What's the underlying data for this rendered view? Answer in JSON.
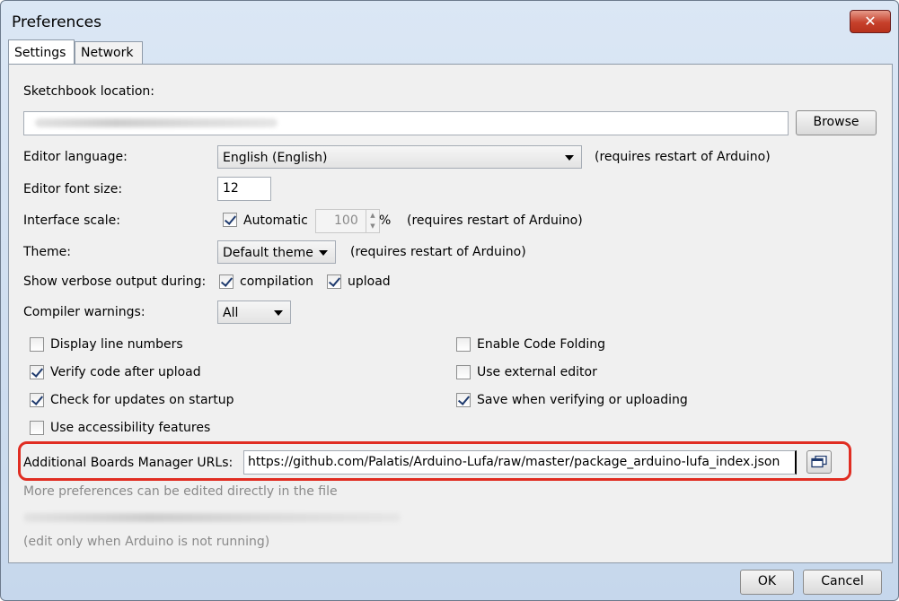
{
  "window": {
    "title": "Preferences",
    "close_glyph": "✕"
  },
  "tabs": [
    {
      "label": "Settings"
    },
    {
      "label": "Network"
    }
  ],
  "sketchbook": {
    "label": "Sketchbook location:",
    "browse_label": "Browse"
  },
  "editor_language": {
    "label": "Editor language:",
    "value": "English (English)",
    "note": "(requires restart of Arduino)"
  },
  "font_size": {
    "label": "Editor font size:",
    "value": "12"
  },
  "interface_scale": {
    "label": "Interface scale:",
    "automatic_label": "Automatic",
    "automatic_checked": true,
    "value": "100",
    "unit": "%",
    "note": "(requires restart of Arduino)"
  },
  "theme": {
    "label": "Theme:",
    "value": "Default theme",
    "note": "(requires restart of Arduino)"
  },
  "verbose": {
    "label": "Show verbose output during:",
    "compilation_label": "compilation",
    "compilation_checked": true,
    "upload_label": "upload",
    "upload_checked": true
  },
  "compiler_warnings": {
    "label": "Compiler warnings:",
    "value": "All"
  },
  "options_left": [
    {
      "label": "Display line numbers",
      "checked": false
    },
    {
      "label": "Verify code after upload",
      "checked": true
    },
    {
      "label": "Check for updates on startup",
      "checked": true
    },
    {
      "label": "Use accessibility features",
      "checked": false
    }
  ],
  "options_right": [
    {
      "label": "Enable Code Folding",
      "checked": false
    },
    {
      "label": "Use external editor",
      "checked": false
    },
    {
      "label": "Save when verifying or uploading",
      "checked": true
    }
  ],
  "boards_urls": {
    "label": "Additional Boards Manager URLs:",
    "value": "https://github.com/Palatis/Arduino-Lufa/raw/master/package_arduino-lufa_index.json"
  },
  "footer": {
    "more_prefs": "More preferences can be edited directly in the file",
    "edit_note": "(edit only when Arduino is not running)"
  },
  "buttons": {
    "ok": "OK",
    "cancel": "Cancel"
  },
  "colors": {
    "highlight": "#e02d22",
    "close_button": "#c6402b",
    "check": "#1e3a6e"
  },
  "icons": {
    "open_window": "window-icon"
  }
}
